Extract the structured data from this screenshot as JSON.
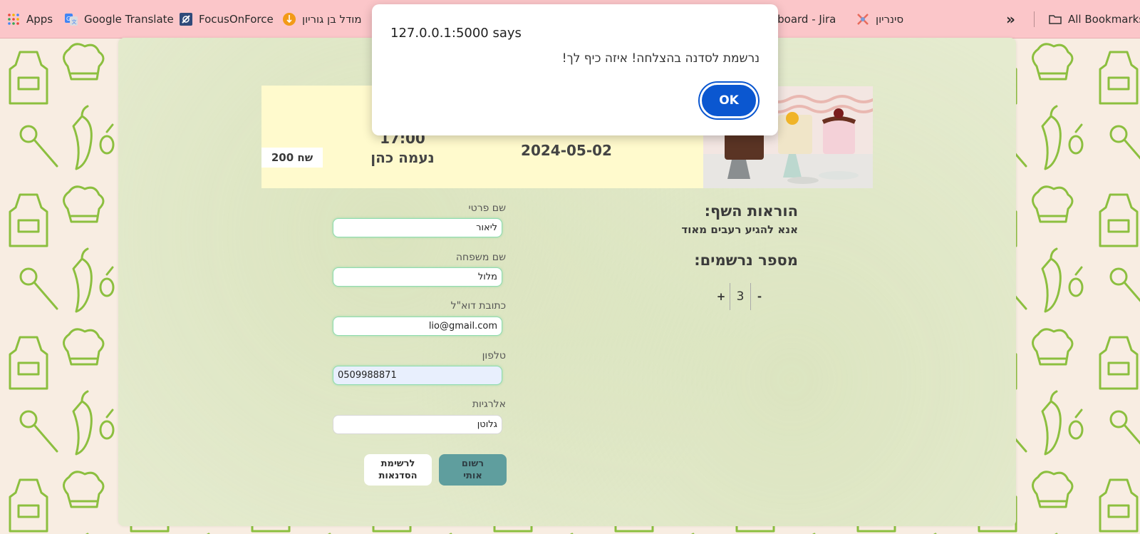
{
  "bookmarks": {
    "apps": "Apps",
    "google_translate": "Google Translate",
    "focusonforce": "FocusOnForce",
    "ben_gurion": "מודל בן גוריון",
    "jira": "L board - Jira",
    "sinarion": "סינריון",
    "all_bookmarks": "All Bookmarks"
  },
  "course": {
    "price": "200 שח",
    "time": "17:00",
    "chef": "נעמה כהן",
    "separator": "-",
    "date": "2024-05-02"
  },
  "instructions": {
    "title": "הוראות השף:",
    "text": "אנא להגיע רעבים מאוד",
    "count_title": "מספר נרשמים:",
    "count": "3",
    "plus": "+",
    "minus": "-"
  },
  "form": {
    "first_name_label": "שם פרטי",
    "first_name_value": "ליאור",
    "last_name_label": "שם משפחה",
    "last_name_value": "מלול",
    "email_label": "כתובת דוא\"ל",
    "email_value": "lio@gmail.com",
    "phone_label": "טלפון",
    "phone_value": "0509988871",
    "allergies_label": "אלרגיות",
    "allergies_value": "גלוטן",
    "back_label_1": "לרשימת",
    "back_label_2": "הסדנאות",
    "register_label_1": "רשום",
    "register_label_2": "אותי"
  },
  "dialog": {
    "title": "127.0.0.1:5000 says",
    "message": "נרשמת לסדנה בהצלחה! איזה כיף לך!",
    "ok": "OK"
  },
  "colors": {
    "bookmark_bar": "#fbc6c9",
    "panel": "#e5ebcf",
    "header_strip": "#fffacd",
    "register_button": "#5f9e9e",
    "ok_button": "#0b57d0",
    "pattern_stroke": "#8cbf3f"
  }
}
